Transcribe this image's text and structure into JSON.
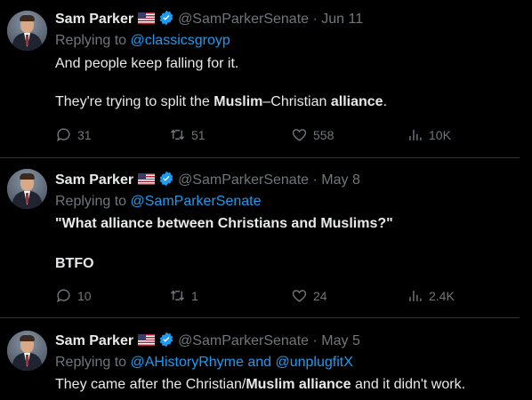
{
  "tweets": [
    {
      "name": "Sam Parker",
      "handle": "@SamParkerSenate",
      "sep": "·",
      "date": "Jun 11",
      "replying_prefix": "Replying to ",
      "replying_to": [
        "@classicsgroyp"
      ],
      "line1": "And people keep falling for it.",
      "line2_parts": [
        "They're trying to split the ",
        "Muslim",
        "–Christian ",
        "alliance",
        "."
      ],
      "replies": "31",
      "reposts": "51",
      "likes": "558",
      "views": "10K"
    },
    {
      "name": "Sam Parker",
      "handle": "@SamParkerSenate",
      "sep": "·",
      "date": "May 8",
      "replying_prefix": "Replying to ",
      "replying_to": [
        "@SamParkerSenate"
      ],
      "line1": "\"What alliance between Christians and Muslims?\"",
      "line2": "BTFO",
      "replies": "10",
      "reposts": "1",
      "likes": "24",
      "views": "2.4K"
    },
    {
      "name": "Sam Parker",
      "handle": "@SamParkerSenate",
      "sep": "·",
      "date": "May 5",
      "replying_prefix": "Replying to ",
      "replying_to": [
        "@AHistoryRhyme",
        "@unplugfitX"
      ],
      "replying_and": " and ",
      "line1_parts": [
        "They came after the Christian/",
        "Muslim alliance",
        " and it didn't work."
      ]
    }
  ]
}
